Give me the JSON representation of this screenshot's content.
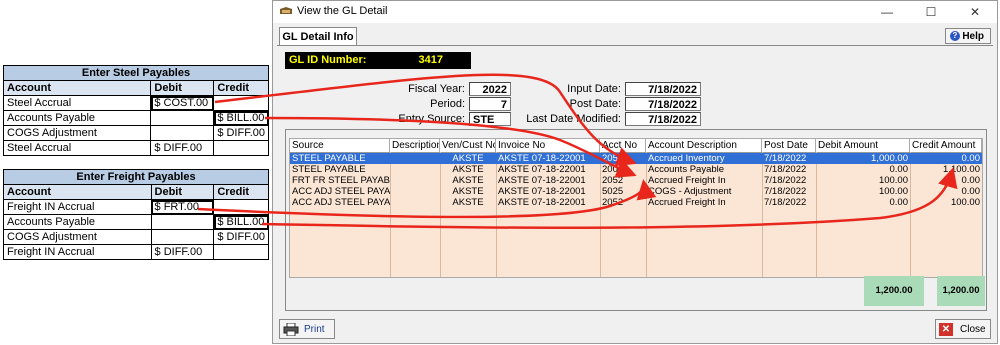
{
  "steel_table": {
    "title": "Enter Steel Payables",
    "headers": [
      "Account",
      "Debit",
      "Credit"
    ],
    "rows": [
      [
        "Steel Accrual",
        "$ COST.00",
        ""
      ],
      [
        "Accounts Payable",
        "",
        "$ BILL.00"
      ],
      [
        "COGS Adjustment",
        "",
        "$ DIFF.00"
      ],
      [
        "Steel Accrual",
        "$ DIFF.00",
        ""
      ]
    ]
  },
  "freight_table": {
    "title": "Enter Freight Payables",
    "headers": [
      "Account",
      "Debit",
      "Credit"
    ],
    "rows": [
      [
        "Freight IN Accrual",
        "$ FRT.00",
        ""
      ],
      [
        "Accounts Payable",
        "",
        "$ BILL.00"
      ],
      [
        "COGS Adjustment",
        "",
        "$ DIFF.00"
      ],
      [
        "Freight IN Accrual",
        "$ DIFF.00",
        ""
      ]
    ]
  },
  "window": {
    "title": "View the GL Detail",
    "minimize": "—",
    "maximize": "☐",
    "close": "✕",
    "tab": "GL Detail Info",
    "help": "Help",
    "help_icon": "?",
    "gl_id_label": "GL ID Number:",
    "gl_id_value": "3417"
  },
  "fields": {
    "fiscal_year_label": "Fiscal Year:",
    "fiscal_year": "2022",
    "period_label": "Period:",
    "period": "7",
    "entry_source_label": "Entry Source:",
    "entry_source": "STE",
    "input_date_label": "Input Date:",
    "input_date": "7/18/2022",
    "post_date_label": "Post Date:",
    "post_date": "7/18/2022",
    "last_modified_label": "Last Date Modified:",
    "last_modified": "7/18/2022"
  },
  "grid": {
    "headers": [
      "Source",
      "Description",
      "Ven/Cust No",
      "Invoice No",
      "Acct No",
      "Account Description",
      "Post Date",
      "Debit Amount",
      "Credit Amount"
    ],
    "rows": [
      [
        "STEEL PAYABLE",
        "",
        "AKSTE",
        "AKSTE 07-18-22001",
        "2051",
        "Accrued Inventory",
        "7/18/2022",
        "1,000.00",
        "0.00"
      ],
      [
        "STEEL PAYABLE",
        "",
        "AKSTE",
        "AKSTE 07-18-22001",
        "2001",
        "Accounts Payable",
        "7/18/2022",
        "0.00",
        "1,100.00"
      ],
      [
        "FRT FR STEEL PAYABLE",
        "",
        "AKSTE",
        "AKSTE 07-18-22001",
        "2052",
        "Accrued Freight In",
        "7/18/2022",
        "100.00",
        "0.00"
      ],
      [
        "ACC ADJ STEEL PAYAB",
        "",
        "AKSTE",
        "AKSTE 07-18-22001",
        "5025",
        "COGS - Adjustment",
        "7/18/2022",
        "100.00",
        "0.00"
      ],
      [
        "ACC ADJ STEEL PAYAB",
        "",
        "AKSTE",
        "AKSTE 07-18-22001",
        "2052",
        "Accrued Freight In",
        "7/18/2022",
        "0.00",
        "100.00"
      ]
    ],
    "selected_row": 0,
    "debit_total": "1,200.00",
    "credit_total": "1,200.00"
  },
  "footer": {
    "print": "Print",
    "close": "Close",
    "close_icon": "✕"
  },
  "colors": {
    "annotation_arrow": "#e8261c",
    "selected_row": "#2f6fd6",
    "grid_background": "#fbe6d6",
    "totals_background": "#a9dbb8",
    "gl_id_text": "#ffff00"
  }
}
